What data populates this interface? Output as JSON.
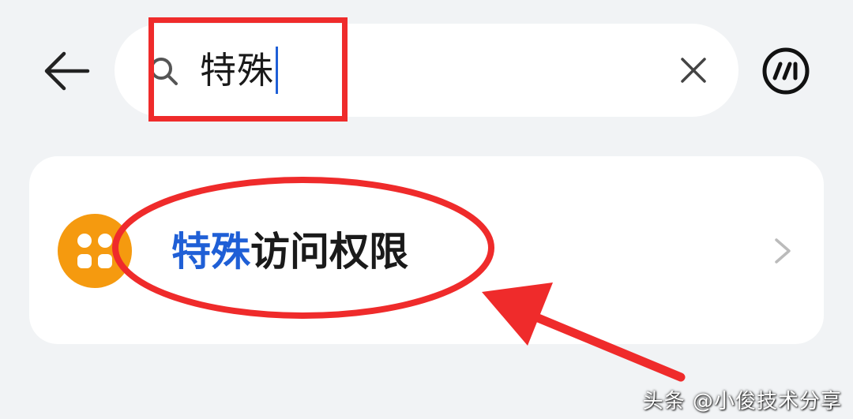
{
  "header": {
    "back_icon": "back-arrow-icon",
    "search": {
      "icon": "search-icon",
      "value": "特殊",
      "clear_icon": "close-icon"
    },
    "ai_icon": "ai-assistant-icon"
  },
  "results": [
    {
      "icon": "grid-apps-icon",
      "highlight": "特殊",
      "rest": "访问权限",
      "chevron_icon": "chevron-right-icon"
    }
  ],
  "watermark": "头条 @小俊技术分享",
  "colors": {
    "background": "#f1f3f5",
    "highlight": "#1f5fd6",
    "app_icon": "#f59a0f",
    "annotation": "#ef2b2b"
  }
}
